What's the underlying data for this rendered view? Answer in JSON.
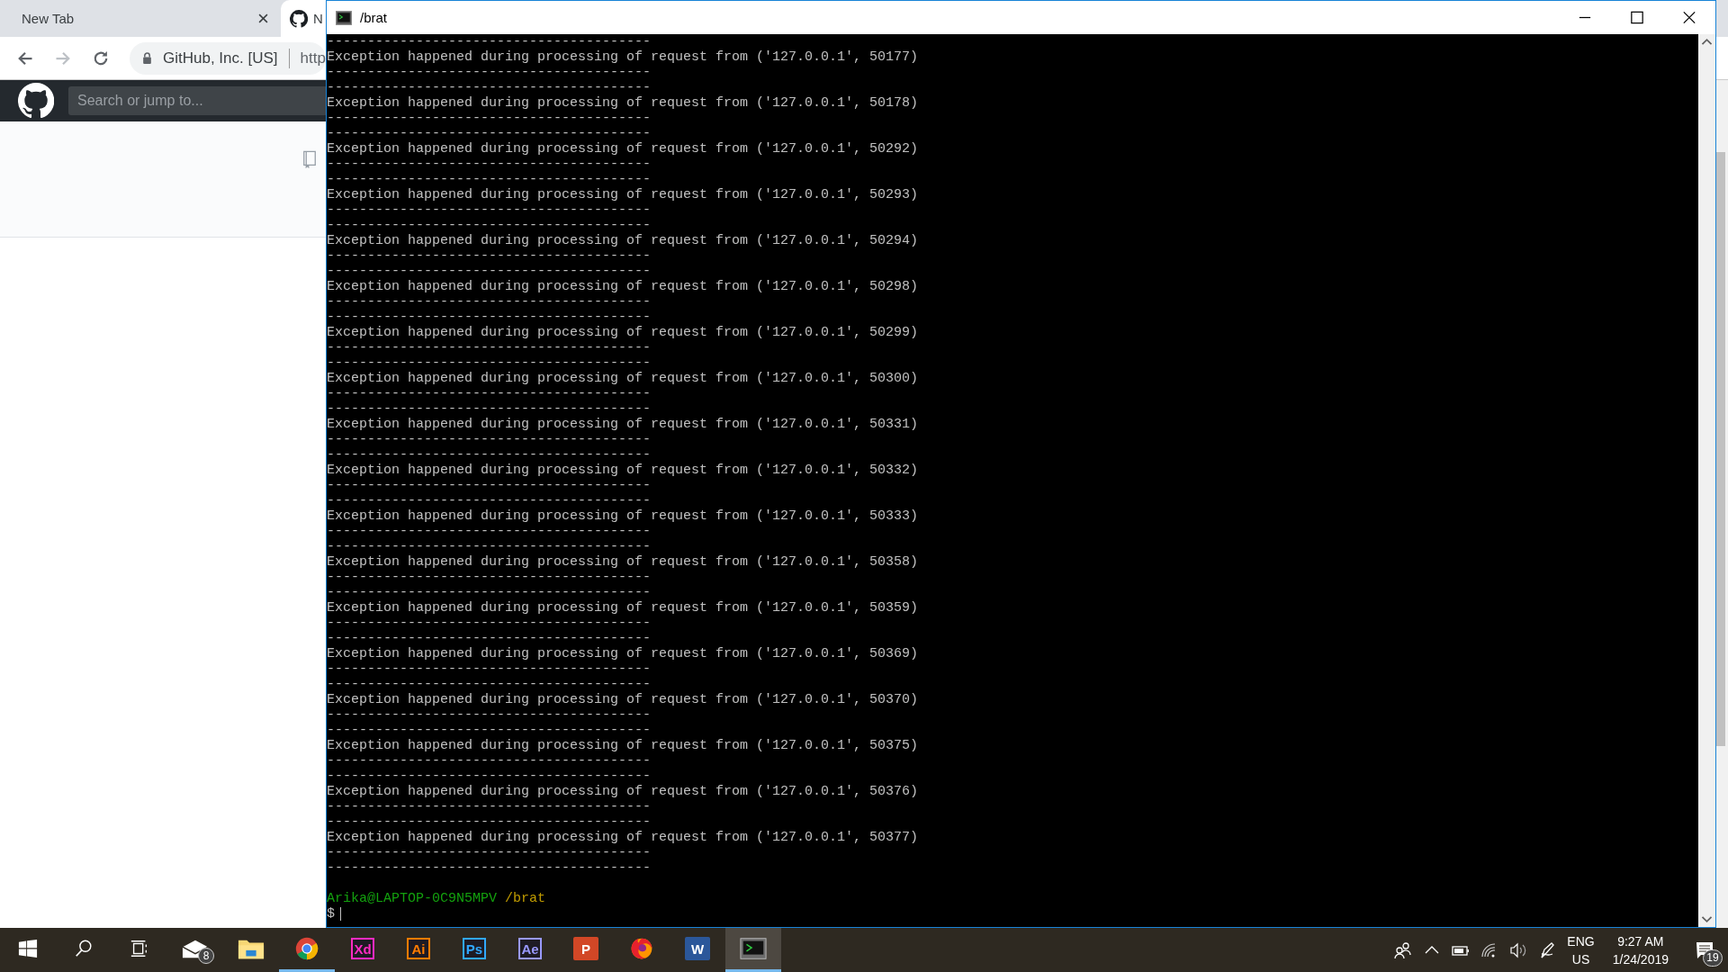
{
  "browser": {
    "tabs": [
      {
        "label": "New Tab",
        "selected": false
      },
      {
        "label": "N",
        "selected": true
      }
    ],
    "address": {
      "site": "GitHub, Inc. [US]",
      "url": "http"
    },
    "search": {
      "placeholder": "Search or jump to..."
    }
  },
  "terminal": {
    "title": "/brat",
    "lines": [
      "----------------------------------------",
      "Exception happened during processing of request from ('127.0.0.1', 50177)",
      "----------------------------------------",
      "----------------------------------------",
      "Exception happened during processing of request from ('127.0.0.1', 50178)",
      "----------------------------------------",
      "----------------------------------------",
      "Exception happened during processing of request from ('127.0.0.1', 50292)",
      "----------------------------------------",
      "----------------------------------------",
      "Exception happened during processing of request from ('127.0.0.1', 50293)",
      "----------------------------------------",
      "----------------------------------------",
      "Exception happened during processing of request from ('127.0.0.1', 50294)",
      "----------------------------------------",
      "----------------------------------------",
      "Exception happened during processing of request from ('127.0.0.1', 50298)",
      "----------------------------------------",
      "----------------------------------------",
      "Exception happened during processing of request from ('127.0.0.1', 50299)",
      "----------------------------------------",
      "----------------------------------------",
      "Exception happened during processing of request from ('127.0.0.1', 50300)",
      "----------------------------------------",
      "----------------------------------------",
      "Exception happened during processing of request from ('127.0.0.1', 50331)",
      "----------------------------------------",
      "----------------------------------------",
      "Exception happened during processing of request from ('127.0.0.1', 50332)",
      "----------------------------------------",
      "----------------------------------------",
      "Exception happened during processing of request from ('127.0.0.1', 50333)",
      "----------------------------------------",
      "----------------------------------------",
      "Exception happened during processing of request from ('127.0.0.1', 50358)",
      "----------------------------------------",
      "----------------------------------------",
      "Exception happened during processing of request from ('127.0.0.1', 50359)",
      "----------------------------------------",
      "----------------------------------------",
      "Exception happened during processing of request from ('127.0.0.1', 50369)",
      "----------------------------------------",
      "----------------------------------------",
      "Exception happened during processing of request from ('127.0.0.1', 50370)",
      "----------------------------------------",
      "----------------------------------------",
      "Exception happened during processing of request from ('127.0.0.1', 50375)",
      "----------------------------------------",
      "----------------------------------------",
      "Exception happened during processing of request from ('127.0.0.1', 50376)",
      "----------------------------------------",
      "----------------------------------------",
      "Exception happened during processing of request from ('127.0.0.1', 50377)",
      "----------------------------------------",
      "----------------------------------------"
    ],
    "prompt": {
      "user": "Arika@LAPTOP-0C9N5MPV",
      "path": "/brat",
      "symbol": "$"
    }
  },
  "taskbar": {
    "apps": [
      {
        "kind": "windows",
        "selected": false
      },
      {
        "kind": "search",
        "selected": false
      },
      {
        "kind": "taskview",
        "selected": false
      },
      {
        "kind": "mail",
        "badge": "8",
        "selected": false
      },
      {
        "kind": "folder",
        "selected": false
      },
      {
        "kind": "chrome",
        "selected": false,
        "running": true
      },
      {
        "kind": "outlined",
        "label": "Xd",
        "color": "#ff2bc2",
        "selected": false
      },
      {
        "kind": "outlined",
        "label": "Ai",
        "color": "#ff7c00",
        "selected": false
      },
      {
        "kind": "outlined",
        "label": "Ps",
        "color": "#31a8ff",
        "selected": false
      },
      {
        "kind": "outlined",
        "label": "Ae",
        "color": "#9999ff",
        "selected": false
      },
      {
        "kind": "filled",
        "label": "P",
        "color": "#d24726",
        "selected": false
      },
      {
        "kind": "firefox",
        "selected": false
      },
      {
        "kind": "filled",
        "label": "W",
        "color": "#2b579a",
        "selected": false
      },
      {
        "kind": "terminal",
        "selected": true,
        "running": true
      }
    ],
    "tray": {
      "language": "ENG",
      "region": "US",
      "time": "9:27 AM",
      "date": "1/24/2019",
      "notifications": "19"
    }
  }
}
